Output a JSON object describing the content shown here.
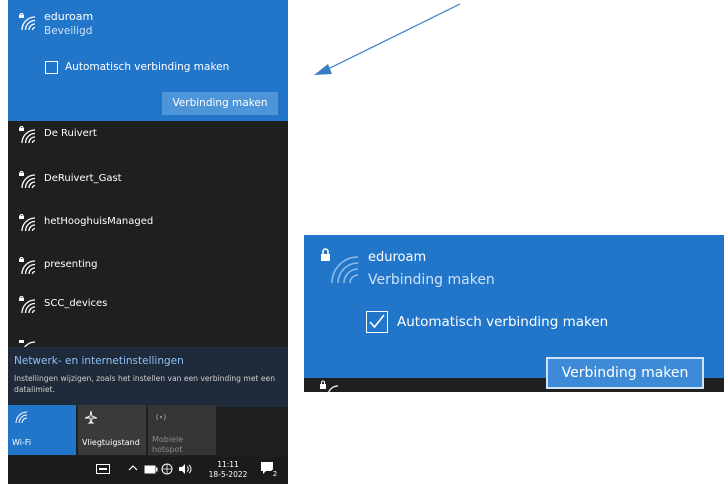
{
  "flyout": {
    "selected_network": {
      "ssid": "eduroam",
      "status": "Beveiligd",
      "auto_connect_label": "Automatisch verbinding maken",
      "auto_connect_checked": false,
      "connect_button": "Verbinding maken"
    },
    "networks": [
      {
        "name": "De Ruivert"
      },
      {
        "name": "DeRuivert_Gast"
      },
      {
        "name": "hetHooghuisManaged"
      },
      {
        "name": "presenting"
      },
      {
        "name": "SCC_devices"
      }
    ],
    "settings": {
      "title": "Netwerk- en internetinstellingen",
      "description": "Instellingen wijzigen, zoals het instellen van een verbinding met een datalimiet."
    },
    "quick_actions": [
      {
        "label": "Wi-Fi",
        "icon": "wifi-icon",
        "active": true
      },
      {
        "label": "Vliegtuigstand",
        "icon": "airplane-icon",
        "active": false
      },
      {
        "label": "Mobiele hotspot",
        "icon": "hotspot-icon",
        "active": false,
        "disabled": true
      }
    ],
    "taskbar": {
      "time": "11:11",
      "date": "18-5-2022",
      "notification_count": "2"
    }
  },
  "zoom": {
    "ssid": "eduroam",
    "status": "Verbinding maken",
    "auto_connect_label": "Automatisch verbinding maken",
    "auto_connect_checked": true,
    "connect_button": "Verbinding maken"
  },
  "colors": {
    "accent": "#2276c9",
    "flyout_bg": "#1f1f1f",
    "arrow": "#3b7dc4"
  }
}
